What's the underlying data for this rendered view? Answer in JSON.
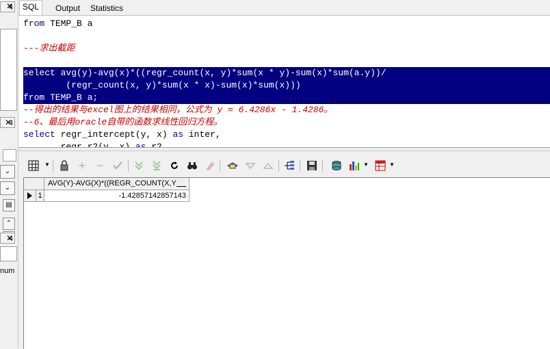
{
  "left_panel": {
    "close_glyph": "✕",
    "digit_label": "4",
    "truncated_text": "num"
  },
  "tabs": [
    {
      "label": "SQL",
      "active": true
    },
    {
      "label": "Output",
      "active": false
    },
    {
      "label": "Statistics",
      "active": false
    }
  ],
  "editor": {
    "lines": [
      {
        "segments": [
          {
            "t": "from",
            "k": "kw"
          },
          {
            "t": " TEMP_B a",
            "k": "id"
          }
        ]
      },
      {
        "segments": []
      },
      {
        "segments": [
          {
            "t": "---求出截距",
            "k": "cm"
          }
        ]
      },
      {
        "segments": []
      },
      {
        "segments": [
          {
            "t": "select",
            "k": "sel"
          },
          {
            "t": " avg(y)-avg(x)*((regr_count(x, y)*sum(x * y)-sum(x)*sum(a.y))/",
            "k": "sel"
          }
        ]
      },
      {
        "segments": [
          {
            "t": "        (regr_count(x, y)*sum(x * x)-sum(x)*sum(x)))",
            "k": "sel"
          }
        ]
      },
      {
        "segments": [
          {
            "t": "from TEMP_B a;",
            "k": "sel"
          }
        ]
      },
      {
        "segments": [
          {
            "t": "--得出的结果与excel图上的结果相同，公式为 y = 6.4286x - 1.4286。",
            "k": "cm"
          }
        ]
      },
      {
        "segments": [
          {
            "t": "--6、最后用oracle自带的函数求线性回归方程。",
            "k": "cm"
          }
        ]
      },
      {
        "segments": [
          {
            "t": "select",
            "k": "kw"
          },
          {
            "t": " regr_intercept(y, x) ",
            "k": "id"
          },
          {
            "t": "as",
            "k": "kw"
          },
          {
            "t": " inter,",
            "k": "id"
          }
        ]
      },
      {
        "segments": [
          {
            "t": "       regr_r2(y, x) ",
            "k": "id"
          },
          {
            "t": "as",
            "k": "kw"
          },
          {
            "t": " r2,",
            "k": "id"
          }
        ]
      }
    ]
  },
  "toolbar": {
    "search_glyph": "🔍"
  },
  "grid": {
    "column_header": "AVG(Y)-AVG(X)*((REGR_COUNT(X,Y",
    "row_number": "1",
    "cell_value": "-1.42857142857143"
  },
  "colors": {
    "selection": "#000080",
    "keyword": "#000080",
    "comment": "#cc0000"
  }
}
